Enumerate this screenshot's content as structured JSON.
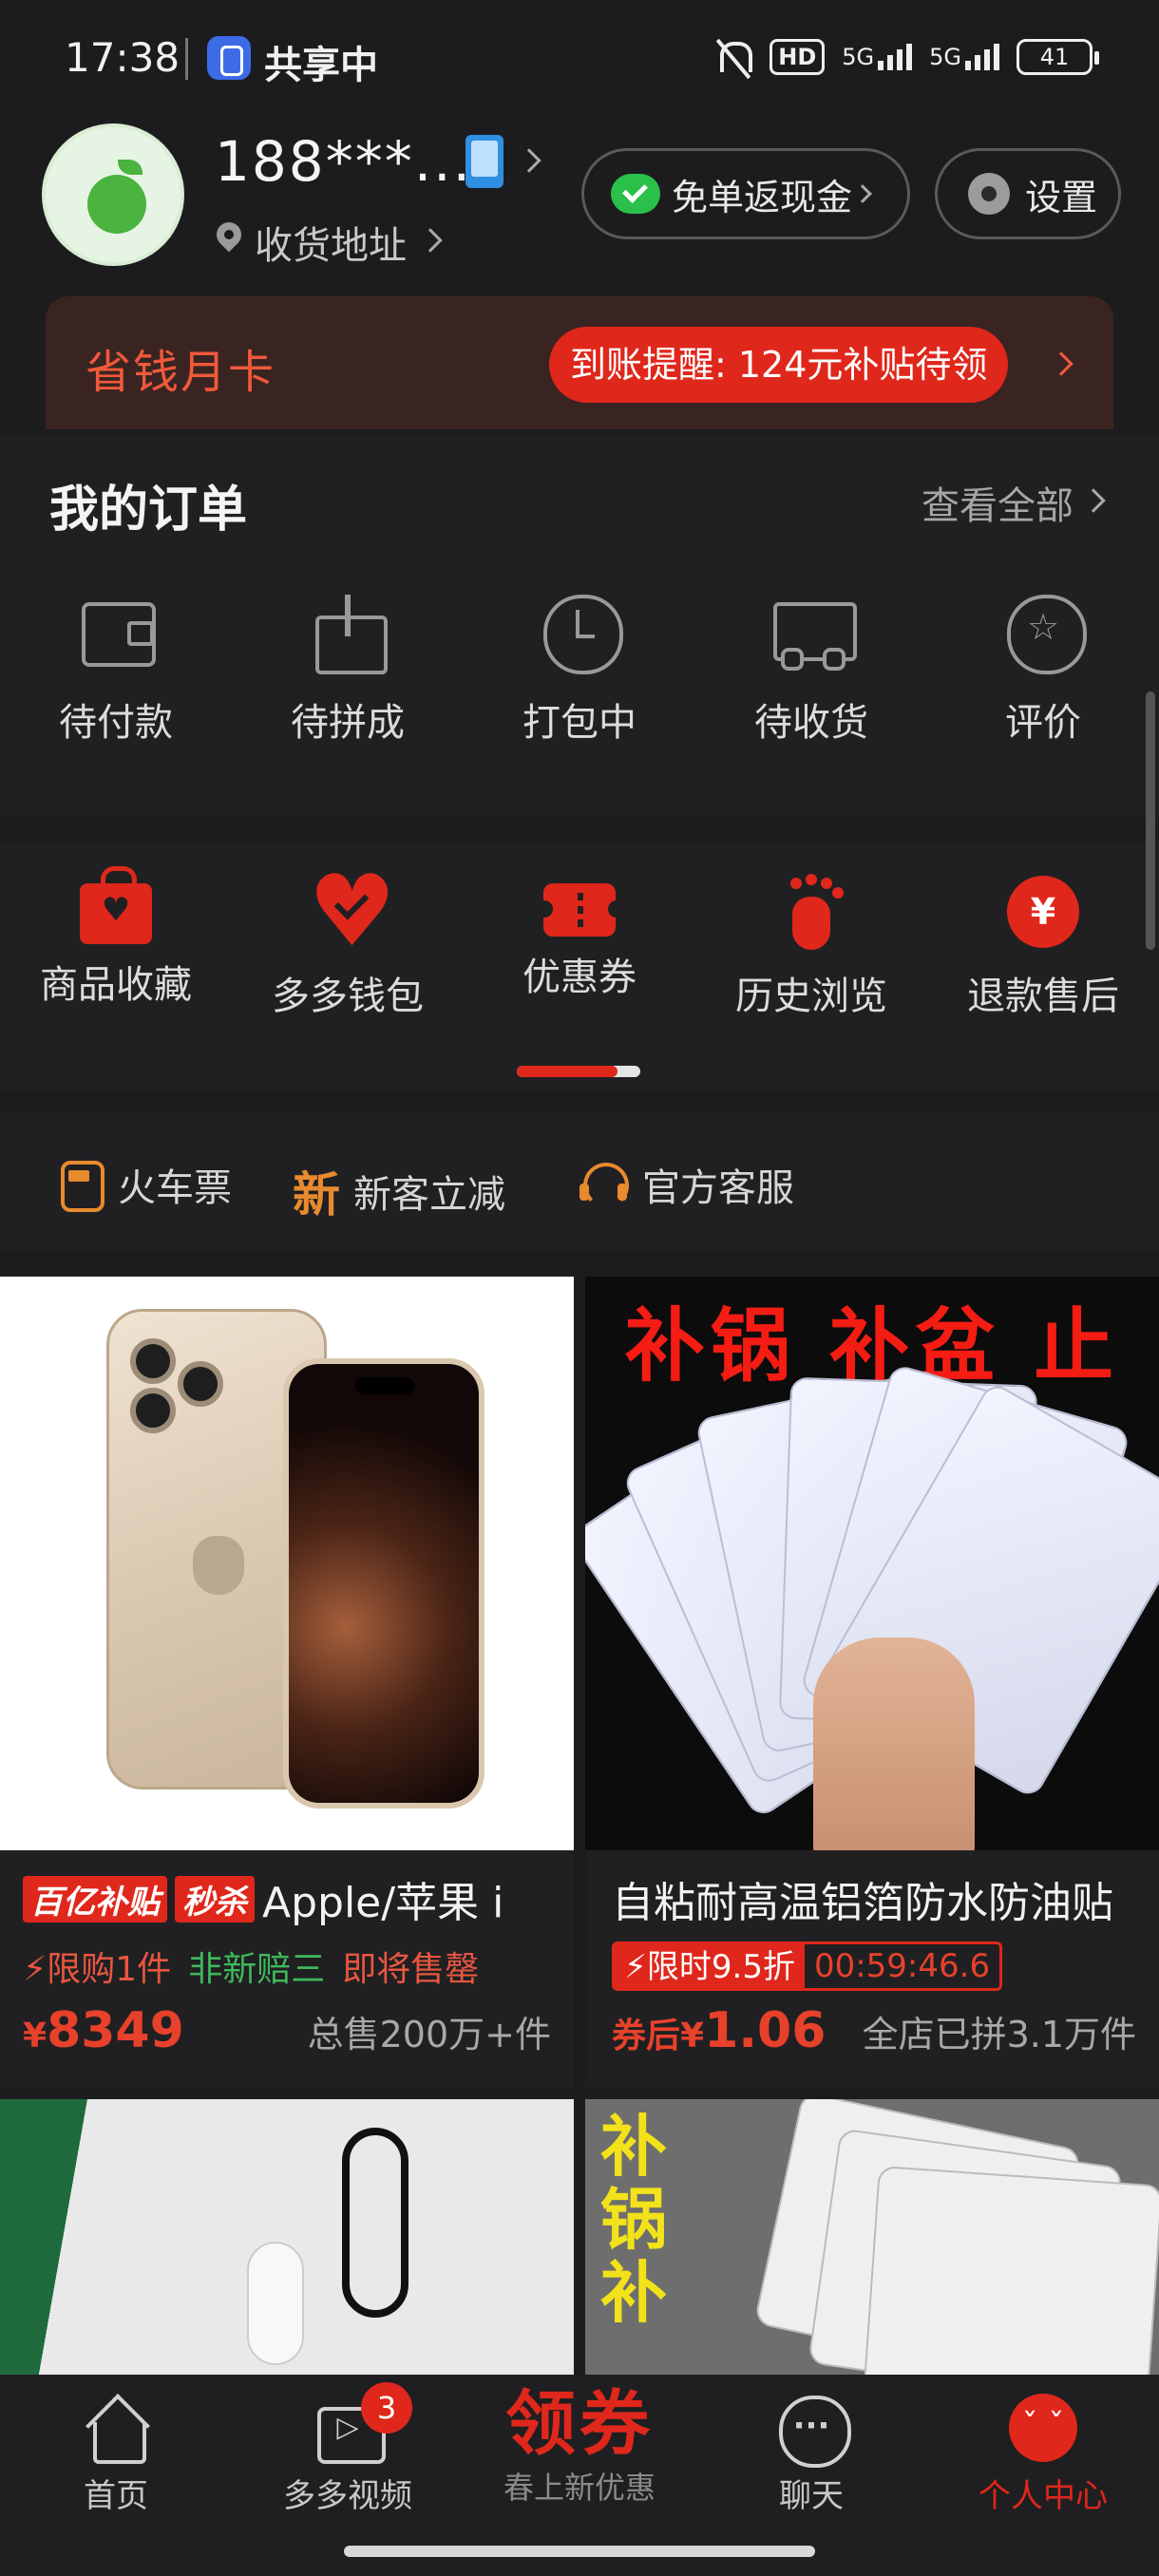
{
  "status_bar": {
    "time": "17:38",
    "share_label": "共享中",
    "hd": "HD",
    "network_1": "5G",
    "network_2": "5G",
    "battery": "41"
  },
  "profile": {
    "username": "188***...",
    "address_label": "收货地址",
    "cashback_label": "免单返现金",
    "settings_label": "设置"
  },
  "monthly_card": {
    "title": "省钱月卡",
    "reminder": "到账提醒: 124元补贴待领"
  },
  "orders": {
    "title": "我的订单",
    "view_all": "查看全部",
    "items": [
      {
        "label": "待付款",
        "icon": "wallet-icon"
      },
      {
        "label": "待拼成",
        "icon": "share-box-icon"
      },
      {
        "label": "打包中",
        "icon": "clock-icon"
      },
      {
        "label": "待收货",
        "icon": "truck-icon"
      },
      {
        "label": "评价",
        "icon": "star-circle-icon"
      }
    ]
  },
  "tools": {
    "items": [
      {
        "label": "商品收藏",
        "icon": "bag-heart-icon"
      },
      {
        "label": "多多钱包",
        "icon": "heart-check-icon"
      },
      {
        "label": "优惠券",
        "icon": "ticket-icon"
      },
      {
        "label": "历史浏览",
        "icon": "footprint-icon"
      },
      {
        "label": "退款售后",
        "icon": "yen-icon"
      }
    ],
    "yen_symbol": "¥"
  },
  "quick_links": {
    "train": "火车票",
    "new_mark": "新",
    "new_user": "新客立减",
    "service": "官方客服"
  },
  "products": [
    {
      "badge_1": "百亿补贴",
      "badge_2": "秒杀",
      "name": "Apple/苹果 i",
      "tag_1": "限购1件",
      "tag_2": "非新赔三",
      "tag_3": "即将售罄",
      "price_symbol": "¥",
      "price": "8349",
      "sold": "总售200万+件"
    },
    {
      "image_text": "补锅 补盆 止漏",
      "name": "自粘耐高温铝箔防水防油贴",
      "flash_label": "限时9.5折",
      "flash_timer": "00:59:46.6",
      "price_prefix": "券后",
      "price_symbol": "¥",
      "price": "1.06",
      "sold": "全店已拼3.1万件"
    },
    {
      "image": "lanyard"
    },
    {
      "image_text_1": "补",
      "image_text_2": "锅",
      "image_text_3": "补"
    }
  ],
  "bottom_nav": {
    "home": "首页",
    "video": "多多视频",
    "video_badge": "3",
    "coupon": "领券",
    "coupon_sub": "春上新优惠",
    "chat": "聊天",
    "me": "个人中心"
  },
  "colors": {
    "accent": "#e0271b",
    "background": "#1c1c1e",
    "orange": "#e88a2e",
    "green": "#3fb85a"
  }
}
